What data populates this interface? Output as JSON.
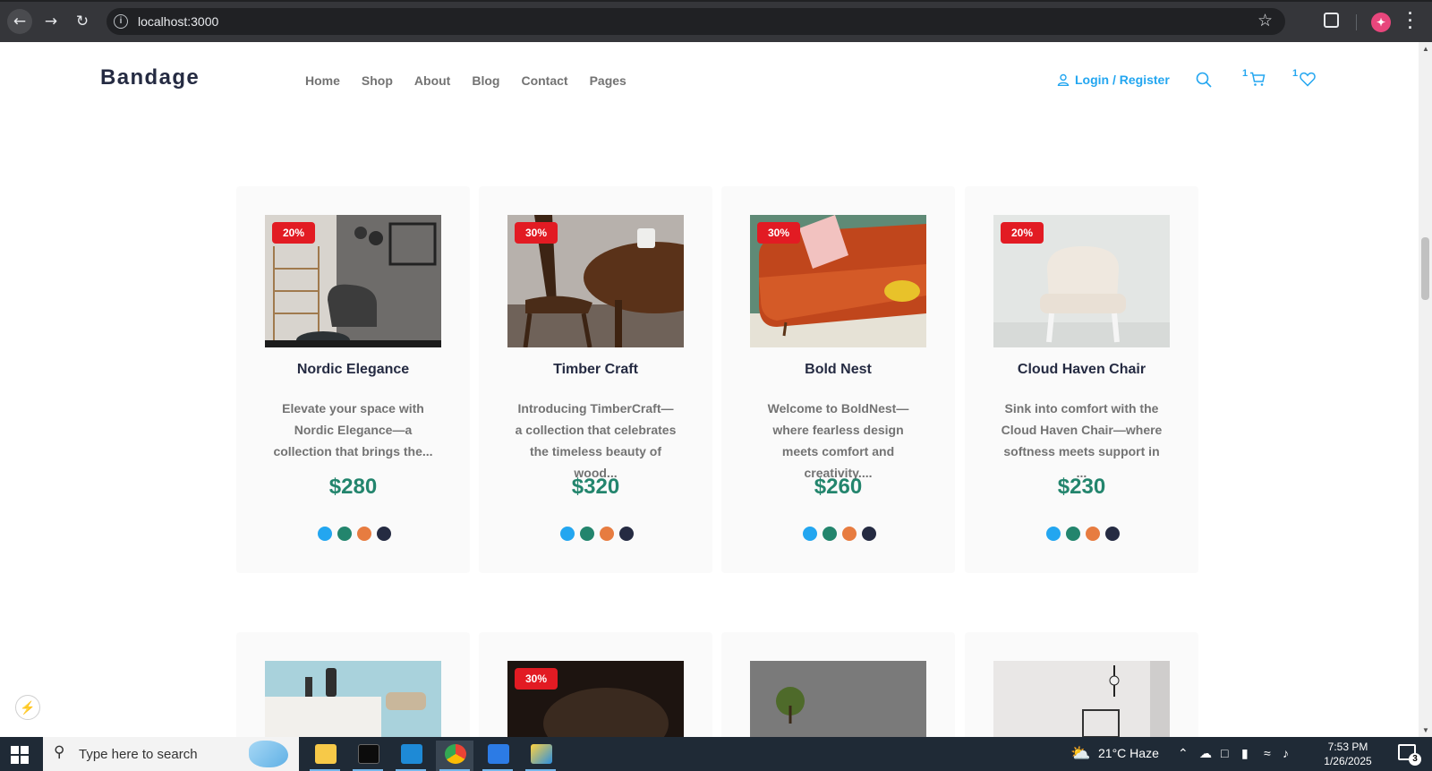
{
  "browser": {
    "url": "localhost:3000",
    "profile_initial": "✦"
  },
  "site": {
    "brand": "Bandage",
    "menu": [
      "Home",
      "Shop",
      "About",
      "Blog",
      "Contact",
      "Pages"
    ],
    "login_label": "Login / Register",
    "cart_count": "1",
    "wishlist_count": "1"
  },
  "products": [
    {
      "badge": "20%",
      "title": "Nordic Elegance",
      "description": "Elevate your space with Nordic Elegance—a collection that brings the...",
      "price": "$280",
      "image": "grey armchair room with shelves and mirrors"
    },
    {
      "badge": "30%",
      "title": "Timber Craft",
      "description": "Introducing TimberCraft—a collection that celebrates the timeless beauty of wood...",
      "price": "$320",
      "image": "wooden chair and round table with mug"
    },
    {
      "badge": "30%",
      "title": "Bold Nest",
      "description": "Welcome to BoldNest— where fearless design meets comfort and creativity....",
      "price": "$260",
      "image": "orange sofa with pink pillow"
    },
    {
      "badge": "20%",
      "title": "Cloud Haven Chair",
      "description": "Sink into comfort with the Cloud Haven Chair—where softness meets support in ...",
      "price": "$230",
      "image": "white tufted chair"
    }
  ],
  "next_row": [
    {
      "badge": "",
      "image": "light blue room with sideboard and chair"
    },
    {
      "badge": "30%",
      "image": "dark room"
    },
    {
      "badge": "",
      "image": "bonsai tree grey backdrop"
    },
    {
      "badge": "",
      "image": "white room with floor lamp"
    }
  ],
  "swatch_colors": [
    "#23a6f0",
    "#23856d",
    "#e77c40",
    "#252b42"
  ],
  "colors": {
    "brand_dark": "#252b42",
    "accent_blue": "#23a6f0",
    "price_green": "#23856d",
    "badge_red": "#e21b23"
  },
  "taskbar": {
    "search_placeholder": "Type here to search",
    "weather": "21°C  Haze",
    "time": "7:53 PM",
    "date": "1/26/2025",
    "notifications": "3"
  }
}
